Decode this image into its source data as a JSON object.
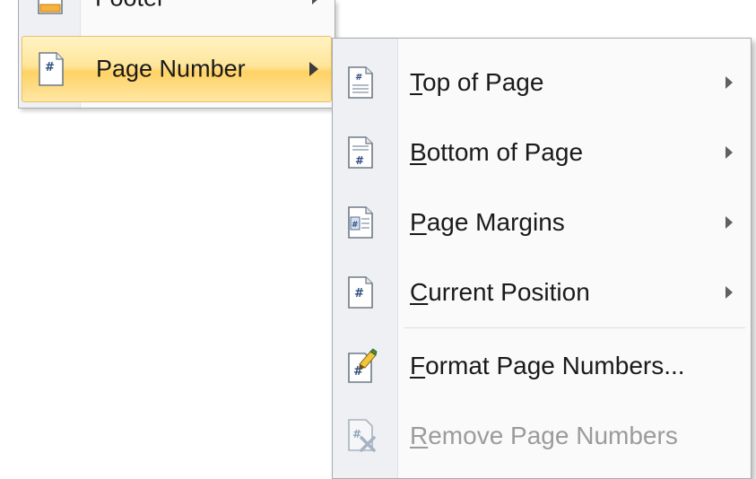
{
  "parent_menu": {
    "items": [
      {
        "label": "Footer",
        "icon": "footer-icon",
        "has_submenu": true
      },
      {
        "label": "Page Number",
        "icon": "page-number-icon",
        "has_submenu": true,
        "highlighted": true
      }
    ]
  },
  "submenu": {
    "items": [
      {
        "accel": "T",
        "rest": "op of Page",
        "icon": "top-of-page-icon",
        "has_submenu": true,
        "enabled": true
      },
      {
        "accel": "B",
        "rest": "ottom of Page",
        "icon": "bottom-of-page-icon",
        "has_submenu": true,
        "enabled": true
      },
      {
        "accel": "P",
        "rest": "age Margins",
        "icon": "page-margins-icon",
        "has_submenu": true,
        "enabled": true
      },
      {
        "accel": "C",
        "rest": "urrent Position",
        "icon": "current-position-icon",
        "has_submenu": true,
        "enabled": true
      },
      {
        "accel": "F",
        "rest": "ormat Page Numbers...",
        "icon": "format-page-numbers-icon",
        "has_submenu": false,
        "enabled": true
      },
      {
        "accel": "R",
        "rest": "emove Page Numbers",
        "icon": "remove-page-numbers-icon",
        "has_submenu": false,
        "enabled": false
      }
    ]
  },
  "colors": {
    "highlight_top": "#fff3c4",
    "highlight_bottom": "#ffd265",
    "highlight_border": "#e7c163",
    "menu_background": "#fafafa",
    "gutter": "#eef0f3",
    "disabled_text": "#9b9b9b"
  }
}
